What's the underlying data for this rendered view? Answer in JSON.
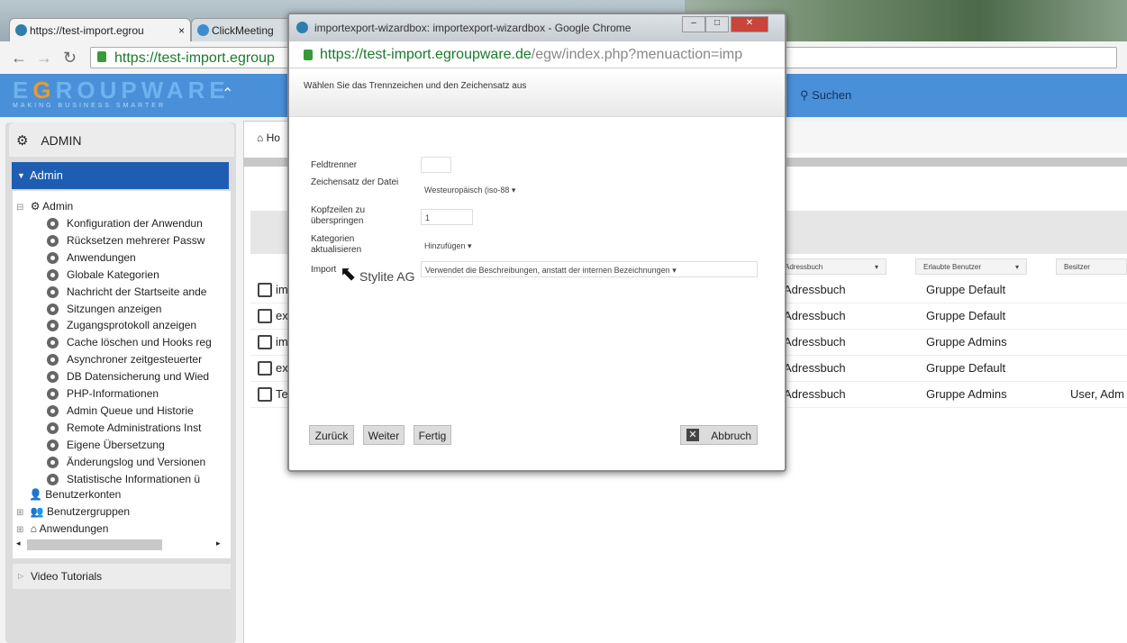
{
  "browser": {
    "tabs": [
      {
        "label": "https://test-import.egrou",
        "close": "×"
      },
      {
        "label": "ClickMeeting"
      }
    ],
    "url": "https://test-import.egroup"
  },
  "app": {
    "logo_prefix": "E",
    "logo_g": "G",
    "logo_rest": "ROUPWARE",
    "slogan": "MAKING BUSINESS SMARTER",
    "search": "Suchen",
    "home_tab": "Ho"
  },
  "sidebar": {
    "title": "ADMIN",
    "section": "Admin",
    "tree_root": "Admin",
    "items": [
      "Konfiguration der Anwendun",
      "Rücksetzen mehrerer Passw",
      "Anwendungen",
      "Globale Kategorien",
      "Nachricht der Startseite ande",
      "Sitzungen anzeigen",
      "Zugangsprotokoll anzeigen",
      "Cache löschen und Hooks reg",
      "Asynchroner zeitgesteuerter",
      "DB Datensicherung und Wied",
      "PHP-Informationen",
      "Admin Queue und Historie",
      "Remote Administrations Inst",
      "Eigene Übersetzung",
      "Änderungslog und Versionen",
      "Statistische Informationen ü"
    ],
    "groups": [
      "Benutzerkonten",
      "Benutzergruppen",
      "Anwendungen"
    ],
    "video": "Video Tutorials"
  },
  "table": {
    "columns": [
      "Adressbuch",
      "Erlaubte Benutzer",
      "Besitzer"
    ],
    "rows": [
      {
        "name": "im",
        "app": "Adressbuch",
        "users": "Gruppe Default",
        "owner": ""
      },
      {
        "name": "ex",
        "app": "Adressbuch",
        "users": "Gruppe Default",
        "owner": ""
      },
      {
        "name": "im",
        "app": "Adressbuch",
        "users": "Gruppe Admins",
        "owner": ""
      },
      {
        "name": "ex",
        "app": "Adressbuch",
        "users": "Gruppe Default",
        "owner": ""
      },
      {
        "name": "Te",
        "app": "Adressbuch",
        "users": "Gruppe Admins",
        "owner": "User, Adm"
      }
    ]
  },
  "popup": {
    "title": "importexport-wizardbox: importexport-wizardbox - Google Chrome",
    "url_main": "https://test-import.egroupware.de",
    "url_rest": "/egw/index.php?menuaction=imp",
    "heading": "Wählen Sie das Trennzeichen und den Zeichensatz aus",
    "fields": {
      "separator_label": "Feldtrenner",
      "separator_value": "",
      "charset_label": "Zeichensatz der Datei",
      "charset_value": "Westeuropäisch (iso-88",
      "skip_label": "Kopfzeilen zu überspringen",
      "skip_value": "1",
      "cat_label": "Kategorien aktualisieren",
      "cat_value": "Hinzufügen",
      "import_label": "Import",
      "import_value": "Verwendet die Beschreibungen, anstatt der internen Bezeichnungen"
    },
    "buttons": {
      "back": "Zurück",
      "next": "Weiter",
      "finish": "Fertig",
      "cancel": "Abbruch"
    },
    "watermark": "Stylite AG"
  }
}
